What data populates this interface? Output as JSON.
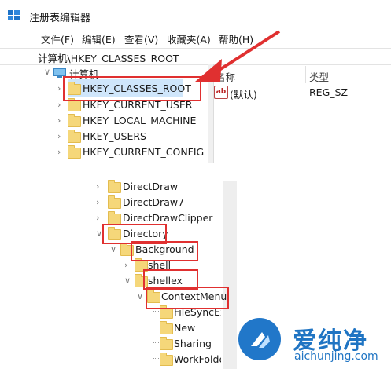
{
  "window": {
    "title": "注册表编辑器"
  },
  "menu": [
    "文件(F)",
    "编辑(E)",
    "查看(V)",
    "收藏夹(A)",
    "帮助(H)"
  ],
  "address": "计算机\\HKEY_CLASSES_ROOT",
  "tree": {
    "root": "计算机",
    "hives": [
      "HKEY_CLASSES_ROOT",
      "HKEY_CURRENT_USER",
      "HKEY_LOCAL_MACHINE",
      "HKEY_USERS",
      "HKEY_CURRENT_CONFIG"
    ]
  },
  "list": {
    "col_name": "名称",
    "col_type": "类型",
    "rows": [
      {
        "name": "(默认)",
        "type": "REG_SZ",
        "icon": "ab"
      }
    ]
  },
  "subtree": {
    "items": [
      "DirectDraw",
      "DirectDraw7",
      "DirectDrawClipper",
      "Directory",
      "Background",
      "shell",
      "shellex",
      "ContextMenu",
      "FileSyncEx",
      "New",
      "Sharing",
      "WorkFolders"
    ]
  },
  "watermark": {
    "brand": "爱纯净",
    "url": "aichunjing.com"
  },
  "colors": {
    "highlight": "#e03030",
    "selection": "#cfe6fb",
    "folder": "#f5d77a",
    "brand": "#1f74c3"
  }
}
